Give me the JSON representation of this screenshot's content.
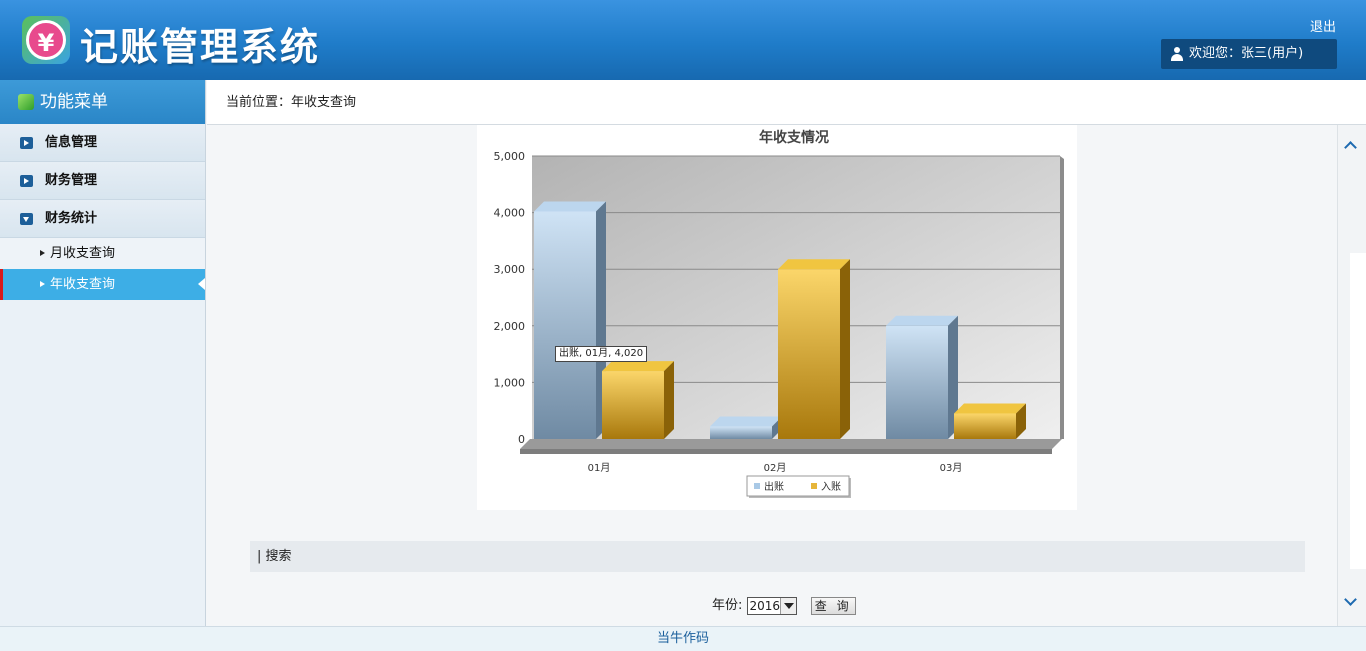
{
  "header": {
    "logo_glyph": "¥",
    "title": "记账管理系统",
    "logout": "退出",
    "welcome": "欢迎您：张三(用户)"
  },
  "sidebar": {
    "title": "功能菜单",
    "items": [
      {
        "label": "信息管理"
      },
      {
        "label": "财务管理"
      },
      {
        "label": "财务统计"
      }
    ],
    "sub_items": [
      {
        "label": "月收支查询"
      },
      {
        "label": "年收支查询"
      }
    ]
  },
  "breadcrumb": "当前位置：年收支查询",
  "chart_data": {
    "type": "bar",
    "title": "年收支情况",
    "categories": [
      "01月",
      "02月",
      "03月"
    ],
    "series": [
      {
        "name": "出账",
        "values": [
          4020,
          220,
          2000
        ],
        "color": "#a9c9e6"
      },
      {
        "name": "入账",
        "values": [
          1200,
          3000,
          450
        ],
        "color": "#e6b53a"
      }
    ],
    "ylim": [
      0,
      5000
    ],
    "yticks": [
      "0",
      "1,000",
      "2,000",
      "3,000",
      "4,000",
      "5,000"
    ],
    "grid": true,
    "legend": "bottom"
  },
  "tooltip": "出账, 01月, 4,020",
  "search": {
    "bar_label": "| 搜索",
    "year_label": "年份:",
    "year_value": "2016",
    "query_button": "查 询"
  },
  "footer": "当牛作码"
}
